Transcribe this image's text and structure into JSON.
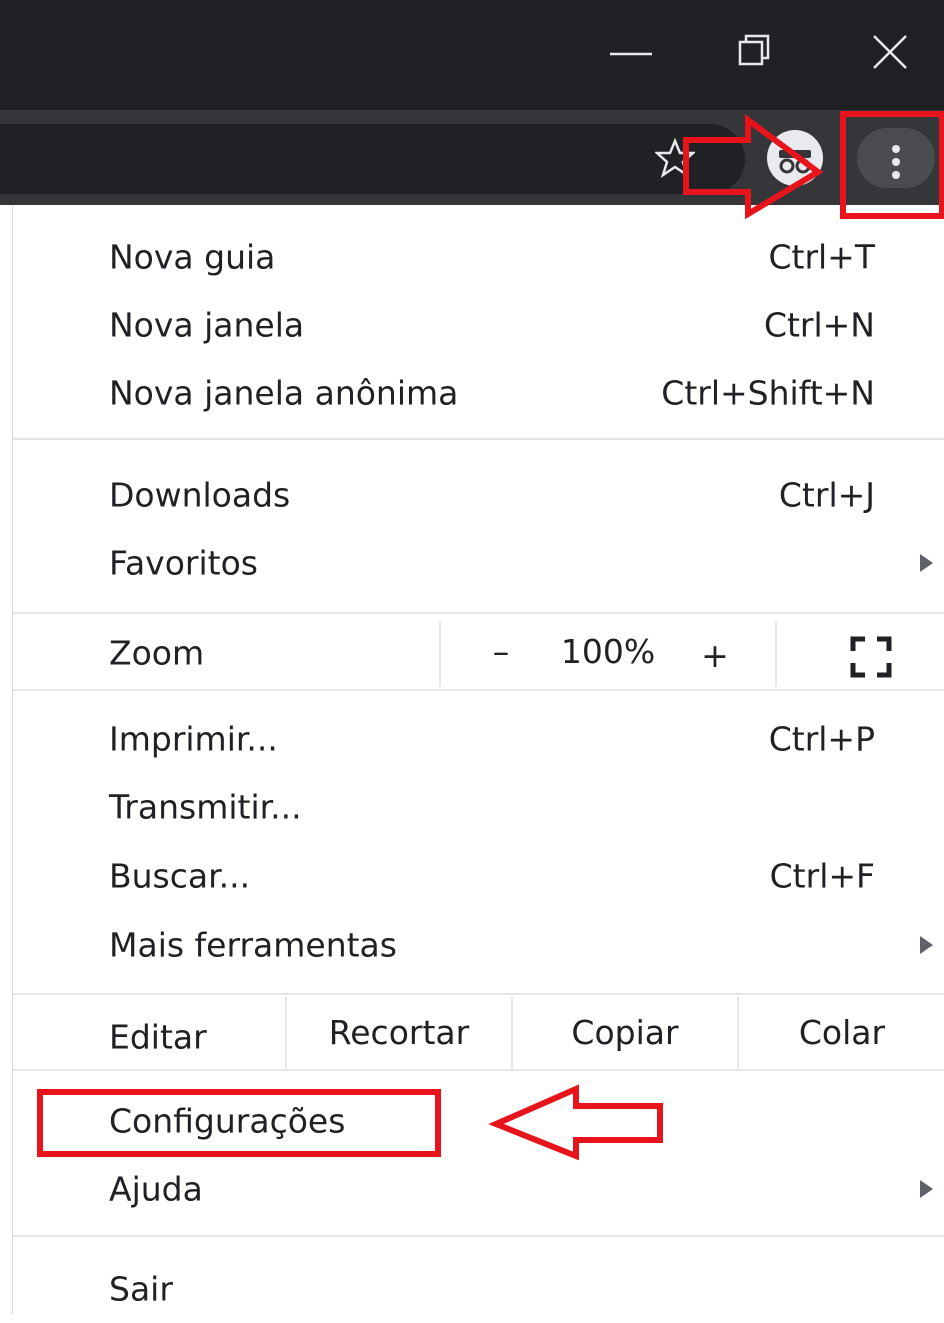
{
  "menu": {
    "group1": [
      {
        "label": "Nova guia",
        "shortcut": "Ctrl+T"
      },
      {
        "label": "Nova janela",
        "shortcut": "Ctrl+N"
      },
      {
        "label": "Nova janela anônima",
        "shortcut": "Ctrl+Shift+N"
      }
    ],
    "group2": [
      {
        "label": "Downloads",
        "shortcut": "Ctrl+J"
      },
      {
        "label": "Favoritos"
      }
    ],
    "zoom": {
      "label": "Zoom",
      "minus": "–",
      "value": "100%",
      "plus": "+"
    },
    "group3": [
      {
        "label": "Imprimir...",
        "shortcut": "Ctrl+P"
      },
      {
        "label": "Transmitir..."
      },
      {
        "label": "Buscar...",
        "shortcut": "Ctrl+F"
      },
      {
        "label": "Mais ferramentas"
      }
    ],
    "edit": {
      "label": "Editar",
      "cut": "Recortar",
      "copy": "Copiar",
      "paste": "Colar"
    },
    "group4": [
      {
        "label": "Configurações"
      },
      {
        "label": "Ajuda"
      }
    ],
    "exit": {
      "label": "Sair"
    }
  },
  "colors": {
    "titlebar": "#202124",
    "toolbar": "#35363a",
    "annotation": "#e8141c"
  },
  "icons": [
    "minimize-icon",
    "restore-icon",
    "close-icon",
    "star-icon",
    "profile-icon",
    "more-vert-icon",
    "fullscreen-icon",
    "chevron-right-icon"
  ]
}
